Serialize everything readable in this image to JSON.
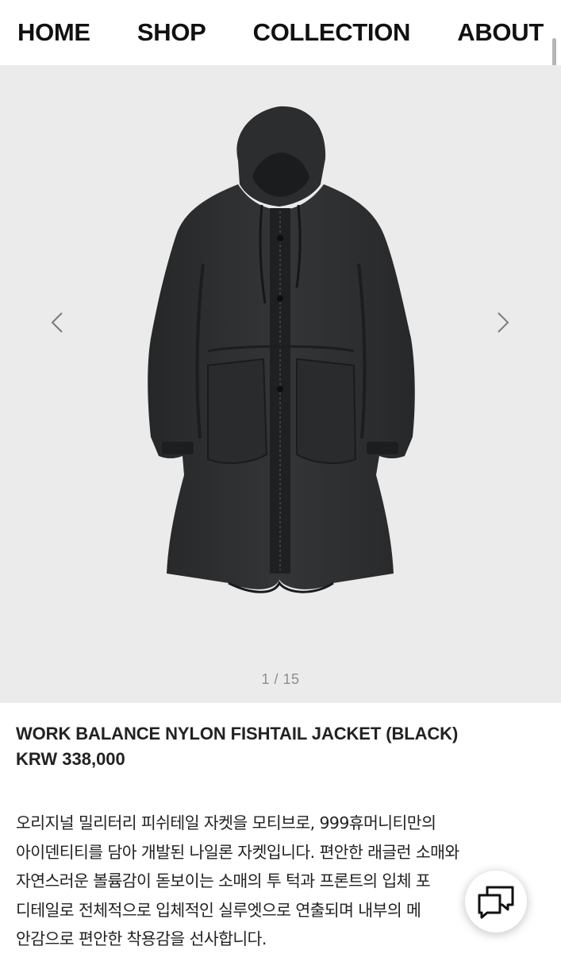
{
  "nav": {
    "items": [
      {
        "label": "HOME"
      },
      {
        "label": "SHOP"
      },
      {
        "label": "COLLECTION"
      },
      {
        "label": "ABOUT"
      }
    ]
  },
  "gallery": {
    "counter": "1 / 15",
    "current_index": 1,
    "total": 15,
    "prev_icon": "chevron-left-icon",
    "next_icon": "chevron-right-icon",
    "background": "#ebebeb"
  },
  "product": {
    "title": "WORK BALANCE NYLON FISHTAIL JACKET (BLACK)",
    "price": "KRW 338,000",
    "description_lines": [
      "오리지널 밀리터리 피쉬테일 자켓을 모티브로, 999휴머니티만의",
      "아이덴티티를 담아 개발된 나일론 자켓입니다. 편안한 래글런 소매와",
      "자연스러운 볼륨감이 돋보이는 소매의 투 턱과 프론트의 입체 포",
      "디테일로 전체적으로 입체적인 실루엣으로 연출되며 내부의 메",
      "안감으로 편안한 착용감을 선사합니다."
    ]
  },
  "chat": {
    "icon": "chat-bubbles-icon"
  }
}
